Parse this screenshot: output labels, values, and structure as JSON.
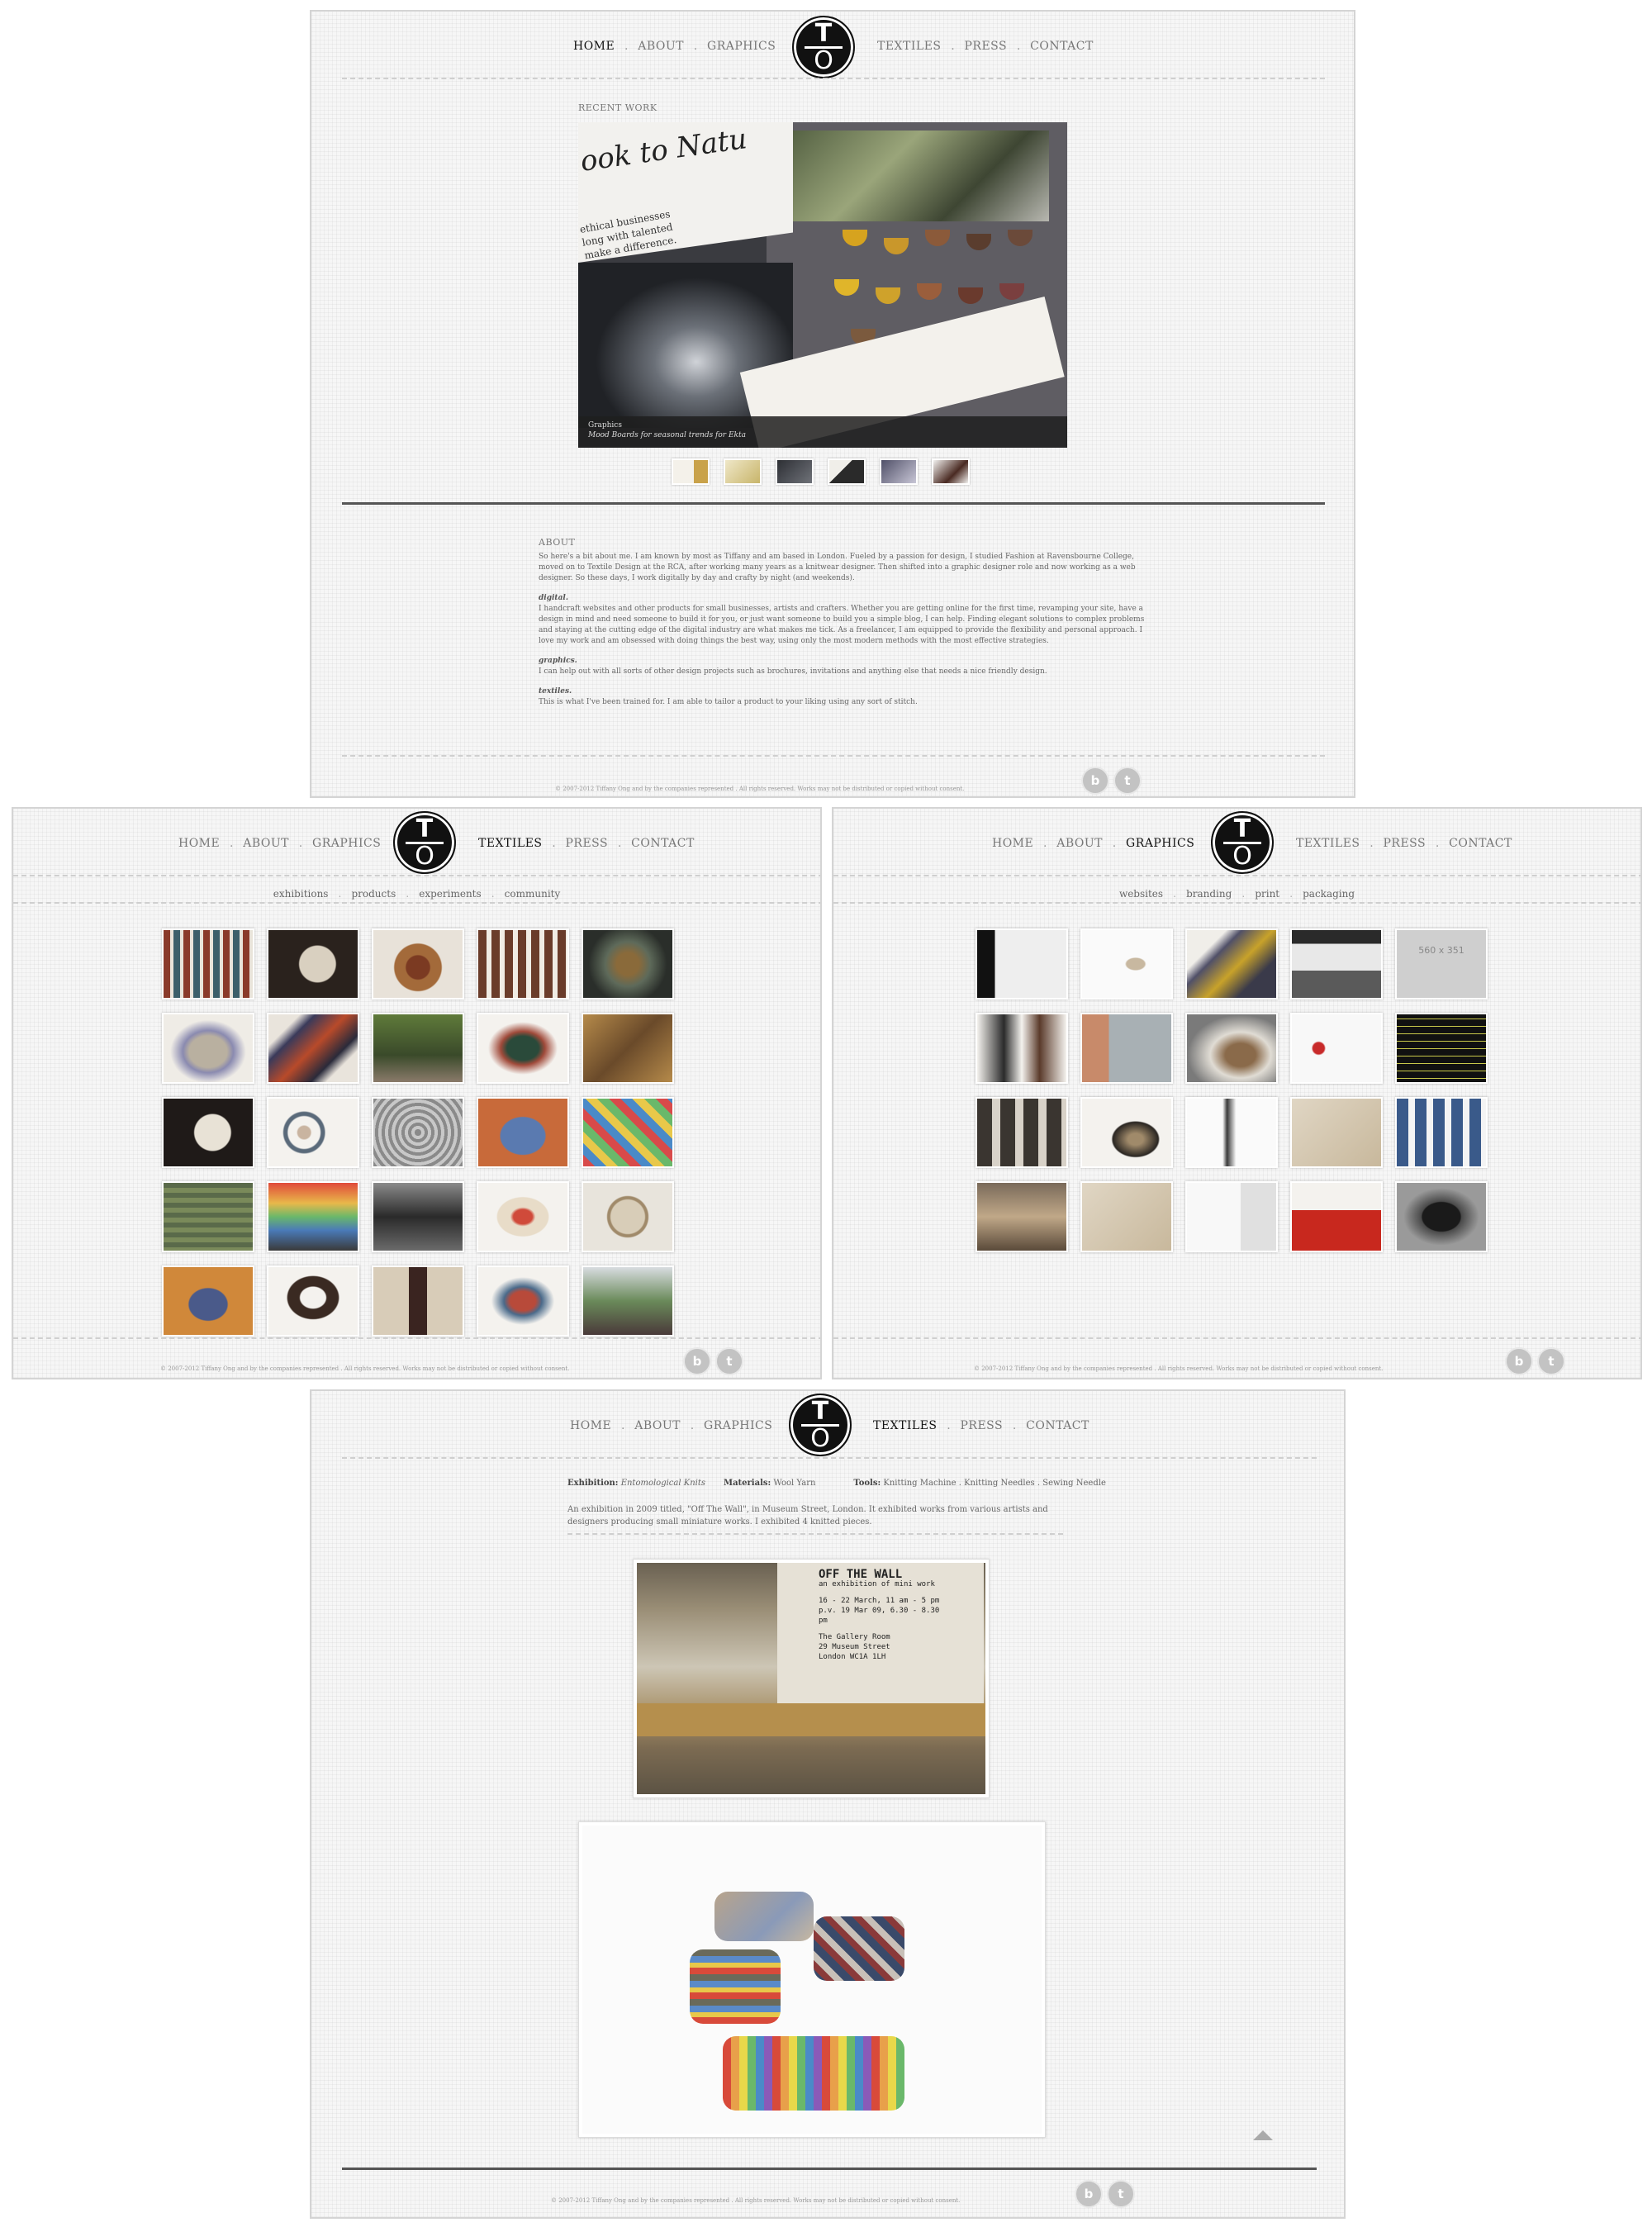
{
  "nav": {
    "items": [
      "HOME",
      "ABOUT",
      "GRAPHICS",
      "TEXTILES",
      "PRESS",
      "CONTACT"
    ],
    "separator": ".",
    "logo_top": "T",
    "logo_bottom": "O"
  },
  "home": {
    "recent_work_label": "RECENT WORK",
    "hero_caption_title": "Graphics",
    "hero_caption_text": "Mood Boards for seasonal trends for Ekta",
    "hero_headline": "ook to Natu",
    "hero_text": "ethical businesses\nlong with talented\nmake a difference.",
    "about_label": "ABOUT",
    "about_intro": "So here's a bit about me. I am known by most as Tiffany and am based in London. Fueled by a passion for design, I studied Fashion at Ravensbourne College, moved on to Textile Design at the RCA, after working many years as a knitwear designer. Then shifted into a graphic designer role and now working as a web designer. So these days, I work digitally by day and crafty by night (and weekends).",
    "sections": [
      {
        "title": "digital.",
        "text": "I handcraft websites and other products for small businesses, artists and crafters. Whether you are getting online for the first time, revamping your site, have a design in mind and need someone to build it for you, or just want someone to build you a simple blog, I can help. Finding elegant solutions to complex problems and staying at the cutting edge of the digital industry are what makes me tick. As a freelancer, I am equipped to provide the flexibility and personal approach. I love my work and am obsessed with doing things the best way, using only the most modern methods with the most effective strategies."
      },
      {
        "title": "graphics.",
        "text": "I can help out with all sorts of other design projects such as brochures, invitations and anything else that needs a nice friendly design."
      },
      {
        "title": "textiles.",
        "text": "This is what I've been trained for. I am able to tailor a product to your liking using any sort of stitch."
      }
    ]
  },
  "footer": {
    "copyright": "© 2007-2012 Tiffany Ong and by the companies represented . All rights reserved. Works may not be distributed or copied without consent.",
    "social": [
      "b",
      "t"
    ]
  },
  "textiles": {
    "subnav": [
      "exhibitions",
      "products",
      "experiments",
      "community"
    ]
  },
  "graphics": {
    "subnav": [
      "websites",
      "branding",
      "print",
      "packaging"
    ],
    "placeholder_text": "560 x 351"
  },
  "exhibition": {
    "exhibition_label": "Exhibition:",
    "exhibition_value": "Entomological Knits",
    "materials_label": "Materials:",
    "materials_value": "Wool Yarn",
    "tools_label": "Tools:",
    "tools_value": "Knitting Machine . Knitting Needles . Sewing Needle",
    "description": "An exhibition in 2009 titled, \"Off The Wall\", in Museum Street, London. It exhibited works from various artists and designers producing small miniature works. I exhibited 4 knitted pieces.",
    "poster_title": "OFF THE WALL",
    "poster_sub": "an exhibition of mini work",
    "poster_lines": [
      "16 - 22 March, 11 am - 5 pm",
      "p.v. 19 Mar 09, 6.30 - 8.30 pm",
      "The Gallery Room",
      "29 Museum Street",
      "London WC1A 1LH"
    ]
  },
  "colors": {
    "background": "#f6f6f6",
    "logo": "#111111",
    "nav_text": "#777777",
    "nav_active": "#111111",
    "divider": "#555555"
  }
}
